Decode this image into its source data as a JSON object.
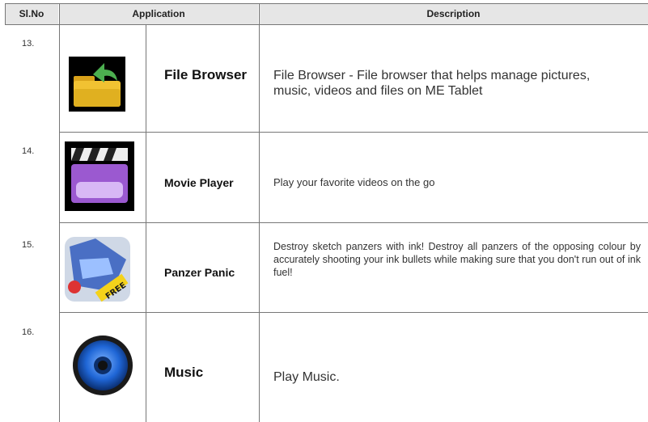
{
  "header": {
    "slno": "Sl.No",
    "application": "Application",
    "description": "Description"
  },
  "rows": [
    {
      "num": "13.",
      "name": "File Browser",
      "icon": "folder-icon",
      "desc": "File Browser - File browser that helps manage pictures, music, videos and files on ME Tablet"
    },
    {
      "num": "14.",
      "name": "Movie Player",
      "icon": "clapperboard-icon",
      "desc": "Play your favorite videos on the go"
    },
    {
      "num": "15.",
      "name": "Panzer Panic",
      "icon": "panzer-panic-icon",
      "icon_text": "FREE",
      "desc": "Destroy sketch panzers with ink! Destroy all panzers of the opposing colour by accurately shooting your ink bullets while making sure that you  don't run out of ink fuel!"
    },
    {
      "num": "16.",
      "name": "Music",
      "icon": "speaker-icon",
      "desc": "Play Music."
    }
  ],
  "colors": {
    "header_bg": "#e6e6e6",
    "grid_line": "#777777"
  }
}
